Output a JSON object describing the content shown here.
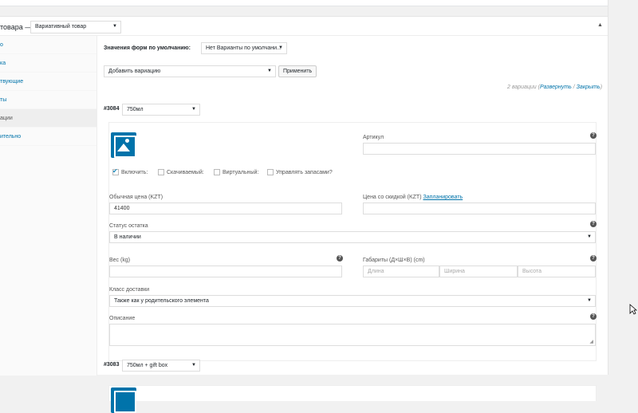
{
  "panel": {
    "title": "товара —",
    "product_type": "Вариативный товар",
    "collapse_glyph": "▲"
  },
  "sidebar": {
    "items": [
      "о",
      "ка",
      "твующие",
      "ты",
      "ации",
      "ительно"
    ],
    "active_index": 4
  },
  "defaults": {
    "label": "Значения форм по умолчанию:",
    "select": "Нет Варианты по умолчани..."
  },
  "bulk": {
    "select": "Добавить вариацию",
    "apply": "Применить",
    "count_prefix": "2 вариации",
    "expand": "Развернуть",
    "sep": " / ",
    "close": "Закрыть",
    "count_suffix": ")"
  },
  "variation1": {
    "id": "#3084",
    "option": "750мл",
    "sku_label": "Артикул",
    "sku_value": "",
    "checkboxes": [
      {
        "label": "Включить:",
        "checked": true
      },
      {
        "label": "Скачиваемый:",
        "checked": false
      },
      {
        "label": "Виртуальный:",
        "checked": false
      },
      {
        "label": "Управлять запасами?",
        "checked": false
      }
    ],
    "regular_price_label": "Обычная цена (KZT)",
    "regular_price": "41400",
    "sale_price_label": "Цена со скидкой (KZT)",
    "schedule": "Запланировать",
    "stock_status_label": "Статус остатка",
    "stock_status": "В наличии",
    "weight_label": "Вес (kg)",
    "dims_label": "Габариты (Д×Ш×В) (cm)",
    "length_ph": "Длина",
    "width_ph": "Ширина",
    "height_ph": "Высота",
    "shipping_label": "Класс доставки",
    "shipping_value": "Также как у родительского элемента",
    "description_label": "Описание"
  },
  "variation2": {
    "id": "#3083",
    "option": "750мл + gift box"
  },
  "colors": {
    "link": "#0073aa",
    "accent": "#1e8cbe"
  }
}
